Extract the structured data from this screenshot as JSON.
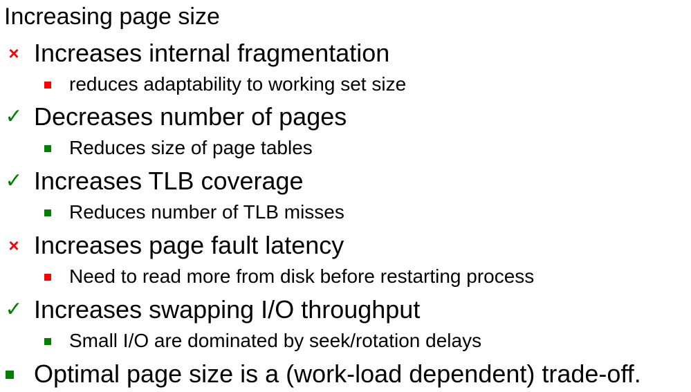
{
  "heading": "Increasing page size",
  "colors": {
    "negative": "#ff0000",
    "positive": "#008000",
    "text": "#000000"
  },
  "items": [
    {
      "marker": "cross",
      "marker_glyph": "×",
      "text": "Increases internal fragmentation",
      "sub": {
        "marker": "square",
        "text": "reduces adaptability to working set size"
      }
    },
    {
      "marker": "check",
      "marker_glyph": "✓",
      "text": "Decreases number of pages",
      "sub": {
        "marker": "square",
        "text": "Reduces size of page tables"
      }
    },
    {
      "marker": "check",
      "marker_glyph": "✓",
      "text": "Increases TLB coverage",
      "sub": {
        "marker": "square",
        "text": "Reduces number of TLB misses"
      }
    },
    {
      "marker": "cross",
      "marker_glyph": "×",
      "text": "Increases page fault latency",
      "sub": {
        "marker": "square",
        "text": "Need to read more from disk before restarting process"
      }
    },
    {
      "marker": "check",
      "marker_glyph": "✓",
      "text": "Increases swapping I/O throughput",
      "sub": {
        "marker": "square",
        "text": "Small I/O are dominated by seek/rotation delays"
      }
    },
    {
      "marker": "square",
      "text": "Optimal page size is a (work-load dependent) trade-off."
    }
  ]
}
